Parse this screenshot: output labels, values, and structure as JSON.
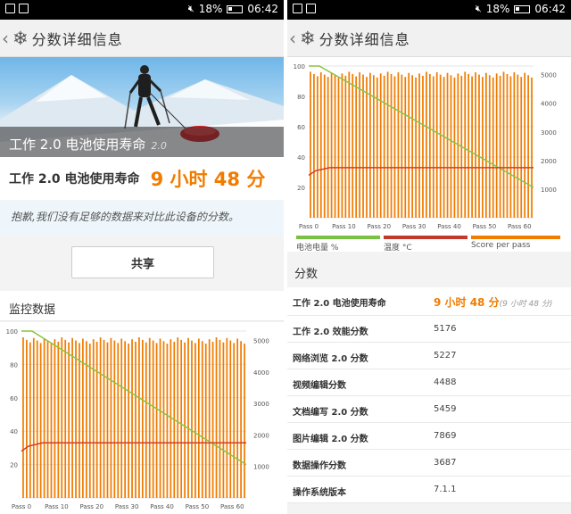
{
  "status_bar": {
    "battery": "18%",
    "time": "06:42"
  },
  "app_bar": {
    "title": "分数详细信息"
  },
  "left": {
    "hero_caption": "工作 2.0 电池使用寿命",
    "hero_caption_version": "2.0",
    "result_label": "工作 2.0 电池使用寿命",
    "result_value": "9 小时 48 分",
    "notice": "抱歉,我们没有足够的数据来对比此设备的分数。",
    "share_label": "共享",
    "monitor_heading": "监控数据"
  },
  "right": {
    "legend": [
      {
        "label": "电池电量 %",
        "color": "#79c043"
      },
      {
        "label": "温度 °C",
        "color": "#c0392b"
      },
      {
        "label": "Score per pass",
        "color": "#f07c00"
      }
    ],
    "score_heading": "分数",
    "rows": [
      {
        "label": "工作 2.0 电池使用寿命",
        "value": "9 小时 48 分",
        "sub": "(9 小时 48 分)"
      },
      {
        "label": "工作 2.0 效能分数",
        "value": "5176"
      },
      {
        "label": "网络浏览 2.0 分数",
        "value": "5227"
      },
      {
        "label": "视频编辑分数",
        "value": "4488"
      },
      {
        "label": "文档编写 2.0 分数",
        "value": "5459"
      },
      {
        "label": "图片编辑 2.0 分数",
        "value": "7869"
      },
      {
        "label": "数据操作分数",
        "value": "3687"
      },
      {
        "label": "操作系统版本",
        "value": "7.1.1"
      }
    ]
  },
  "chart_data": [
    {
      "type": "line",
      "x": {
        "label": "Pass",
        "ticks": [
          "Pass 0",
          "Pass 10",
          "Pass 20",
          "Pass 30",
          "Pass 40",
          "Pass 50",
          "Pass 60"
        ],
        "range": [
          0,
          64
        ]
      },
      "y_left": {
        "ticks": [
          "100",
          "80",
          "60",
          "40",
          "20"
        ],
        "range": [
          0,
          100
        ]
      },
      "y_right": {
        "ticks": [
          "5000",
          "4000",
          "3000",
          "2000",
          "1000"
        ],
        "range": [
          0,
          5300
        ]
      },
      "series": [
        {
          "name": "电池电量 %",
          "color": "#8ac440",
          "axis": "left",
          "points": [
            [
              0,
              100
            ],
            [
              3,
              100
            ],
            [
              64,
              20
            ]
          ]
        },
        {
          "name": "温度 °C",
          "color": "#d23c2a",
          "axis": "left",
          "points": [
            [
              0,
              28
            ],
            [
              2,
              31
            ],
            [
              6,
              33
            ],
            [
              64,
              33
            ]
          ]
        },
        {
          "name": "Score per pass",
          "color": "#f07c00",
          "axis": "right",
          "bars": {
            "count": 64,
            "base": 5000,
            "jitter": 200
          }
        }
      ],
      "grid": true,
      "legend": "bottom"
    }
  ]
}
